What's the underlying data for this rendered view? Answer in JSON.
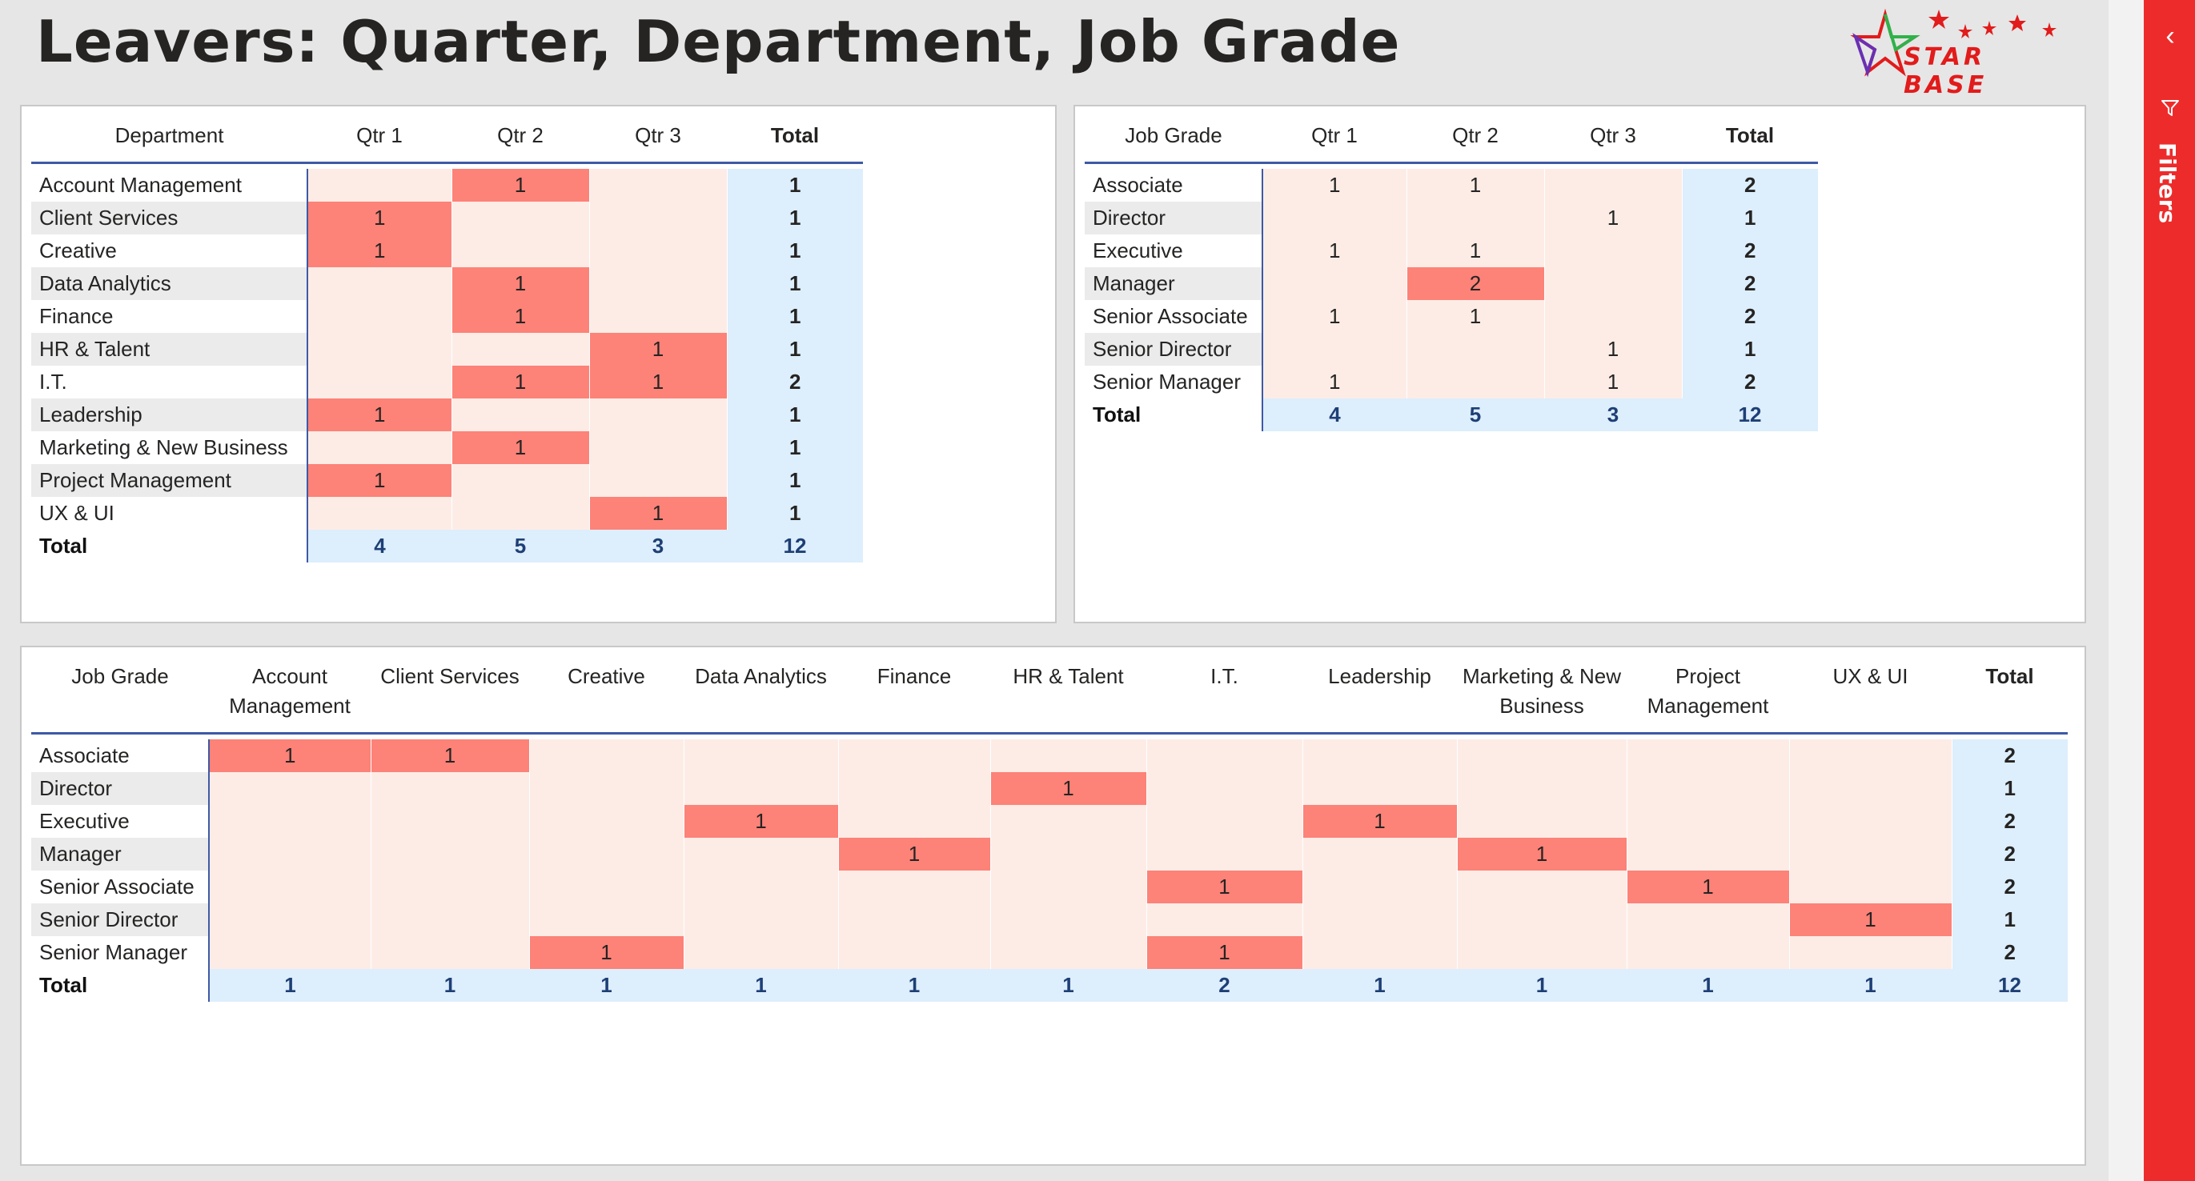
{
  "title": "Leavers: Quarter, Department, Job Grade",
  "logo": {
    "text": "STAR BASE"
  },
  "filters_pane": {
    "label": "Filters",
    "collapse_icon": "chevron-left-icon",
    "filter_icon": "funnel-icon"
  },
  "colors": {
    "highlight": "#fd8278",
    "cell_bg": "#fdece6",
    "total_bg": "#ddeefc",
    "accent_line": "#3e59a6",
    "filters_bg": "#ee2b2b"
  },
  "dept_by_quarter": {
    "row_header": "Department",
    "columns": [
      "Qtr 1",
      "Qtr 2",
      "Qtr 3"
    ],
    "total_label": "Total",
    "rows": [
      {
        "label": "Account Management",
        "values": [
          "",
          "1",
          ""
        ],
        "total": "1"
      },
      {
        "label": "Client Services",
        "values": [
          "1",
          "",
          ""
        ],
        "total": "1"
      },
      {
        "label": "Creative",
        "values": [
          "1",
          "",
          ""
        ],
        "total": "1"
      },
      {
        "label": "Data Analytics",
        "values": [
          "",
          "1",
          ""
        ],
        "total": "1"
      },
      {
        "label": "Finance",
        "values": [
          "",
          "1",
          ""
        ],
        "total": "1"
      },
      {
        "label": "HR & Talent",
        "values": [
          "",
          "",
          "1"
        ],
        "total": "1"
      },
      {
        "label": "I.T.",
        "values": [
          "",
          "1",
          "1"
        ],
        "total": "2"
      },
      {
        "label": "Leadership",
        "values": [
          "1",
          "",
          ""
        ],
        "total": "1"
      },
      {
        "label": "Marketing & New Business",
        "values": [
          "",
          "1",
          ""
        ],
        "total": "1"
      },
      {
        "label": "Project Management",
        "values": [
          "1",
          "",
          ""
        ],
        "total": "1"
      },
      {
        "label": "UX & UI",
        "values": [
          "",
          "",
          "1"
        ],
        "total": "1"
      }
    ],
    "totals": {
      "label": "Total",
      "values": [
        "4",
        "5",
        "3"
      ],
      "total": "12"
    }
  },
  "grade_by_quarter": {
    "row_header": "Job Grade",
    "columns": [
      "Qtr 1",
      "Qtr 2",
      "Qtr 3"
    ],
    "total_label": "Total",
    "rows": [
      {
        "label": "Associate",
        "values": [
          "1",
          "1",
          ""
        ],
        "total": "2"
      },
      {
        "label": "Director",
        "values": [
          "",
          "",
          "1"
        ],
        "total": "1"
      },
      {
        "label": "Executive",
        "values": [
          "1",
          "1",
          ""
        ],
        "total": "2"
      },
      {
        "label": "Manager",
        "values": [
          "",
          "2",
          ""
        ],
        "total": "2"
      },
      {
        "label": "Senior Associate",
        "values": [
          "1",
          "1",
          ""
        ],
        "total": "2"
      },
      {
        "label": "Senior Director",
        "values": [
          "",
          "",
          "1"
        ],
        "total": "1"
      },
      {
        "label": "Senior Manager",
        "values": [
          "1",
          "",
          "1"
        ],
        "total": "2"
      }
    ],
    "totals": {
      "label": "Total",
      "values": [
        "4",
        "5",
        "3"
      ],
      "total": "12"
    }
  },
  "grade_by_dept": {
    "row_header": "Job Grade",
    "columns": [
      "Account Management",
      "Client Services",
      "Creative",
      "Data Analytics",
      "Finance",
      "HR & Talent",
      "I.T.",
      "Leadership",
      "Marketing & New Business",
      "Project Management",
      "UX & UI"
    ],
    "total_label": "Total",
    "rows": [
      {
        "label": "Associate",
        "values": [
          "1",
          "1",
          "",
          "",
          "",
          "",
          "",
          "",
          "",
          "",
          ""
        ],
        "total": "2"
      },
      {
        "label": "Director",
        "values": [
          "",
          "",
          "",
          "",
          "",
          "1",
          "",
          "",
          "",
          "",
          ""
        ],
        "total": "1"
      },
      {
        "label": "Executive",
        "values": [
          "",
          "",
          "",
          "1",
          "",
          "",
          "",
          "1",
          "",
          "",
          ""
        ],
        "total": "2"
      },
      {
        "label": "Manager",
        "values": [
          "",
          "",
          "",
          "",
          "1",
          "",
          "",
          "",
          "1",
          "",
          ""
        ],
        "total": "2"
      },
      {
        "label": "Senior Associate",
        "values": [
          "",
          "",
          "",
          "",
          "",
          "",
          "1",
          "",
          "",
          "1",
          ""
        ],
        "total": "2"
      },
      {
        "label": "Senior Director",
        "values": [
          "",
          "",
          "",
          "",
          "",
          "",
          "",
          "",
          "",
          "",
          "1"
        ],
        "total": "1"
      },
      {
        "label": "Senior Manager",
        "values": [
          "",
          "",
          "1",
          "",
          "",
          "",
          "1",
          "",
          "",
          "",
          ""
        ],
        "total": "2"
      }
    ],
    "totals": {
      "label": "Total",
      "values": [
        "1",
        "1",
        "1",
        "1",
        "1",
        "1",
        "2",
        "1",
        "1",
        "1",
        "1"
      ],
      "total": "12"
    }
  }
}
